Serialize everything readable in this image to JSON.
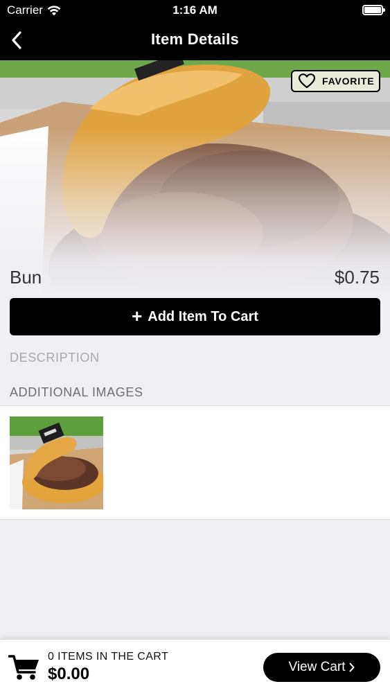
{
  "status_bar": {
    "carrier": "Carrier",
    "time": "1:16 AM"
  },
  "nav": {
    "title": "Item Details",
    "back_icon": "chevron-left-icon"
  },
  "hero": {
    "favorite_label": "FAVORITE",
    "favorite_icon": "heart-outline-icon"
  },
  "item": {
    "name": "Bun",
    "price": "$0.75"
  },
  "actions": {
    "add_to_cart": "Add Item To Cart",
    "add_icon": "plus-icon"
  },
  "sections": {
    "description_header": "DESCRIPTION",
    "additional_images_header": "ADDITIONAL IMAGES"
  },
  "cart": {
    "items_label": "0 ITEMS IN THE CART",
    "total": "$0.00",
    "view_cart": "View Cart",
    "cart_icon": "shopping-cart-icon"
  },
  "colors": {
    "primary": "#000000",
    "background": "#efeff4",
    "favorite_bg": "#e9ecd9"
  }
}
